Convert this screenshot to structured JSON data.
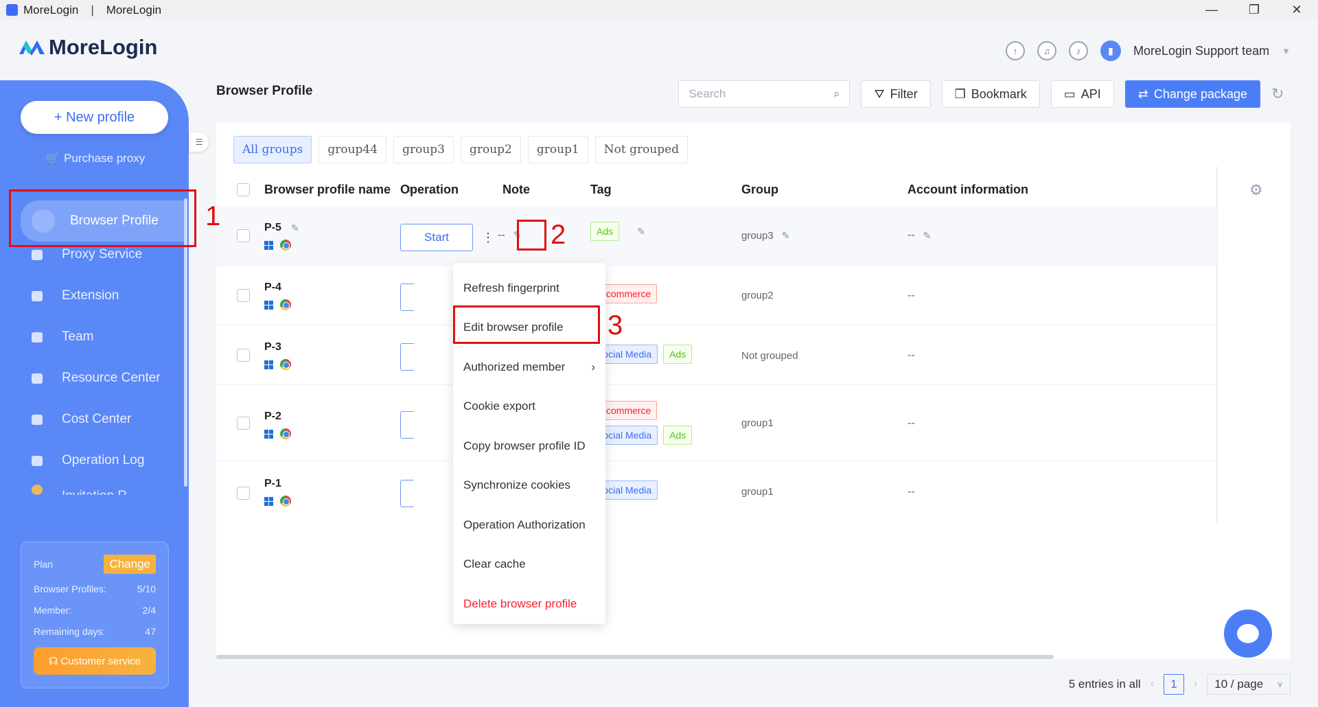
{
  "titlebar": {
    "app_name": "MoreLogin",
    "separator": "|",
    "window_title": "MoreLogin",
    "minimize": "—",
    "maximize": "❐",
    "close": "✕"
  },
  "header": {
    "logo_text": "MoreLogin",
    "team_name": "MoreLogin Support team"
  },
  "sidebar": {
    "new_profile": "+ New profile",
    "purchase_proxy": "Purchase proxy",
    "items": [
      {
        "label": "Browser Profile",
        "icon": "browser-icon"
      },
      {
        "label": "Proxy Service",
        "icon": "proxy-icon"
      },
      {
        "label": "Extension",
        "icon": "puzzle-icon"
      },
      {
        "label": "Team",
        "icon": "team-icon"
      },
      {
        "label": "Resource Center",
        "icon": "cube-icon"
      },
      {
        "label": "Cost Center",
        "icon": "wallet-icon"
      },
      {
        "label": "Operation Log",
        "icon": "log-icon"
      },
      {
        "label": "Invitation R...",
        "icon": "invite-icon"
      }
    ],
    "plan": {
      "title": "Plan",
      "change": "Change",
      "rows": [
        {
          "label": "Browser Profiles:",
          "value": "5/10"
        },
        {
          "label": "Member:",
          "value": "2/4"
        },
        {
          "label": "Remaining days:",
          "value": "47"
        }
      ],
      "customer_service": "Customer service"
    }
  },
  "main": {
    "title": "Browser Profile",
    "search_placeholder": "Search",
    "buttons": {
      "filter": "Filter",
      "bookmark": "Bookmark",
      "api": "API",
      "change_package": "Change package"
    },
    "groups": [
      "All groups",
      "group44",
      "group3",
      "group2",
      "group1",
      "Not grouped"
    ],
    "columns": {
      "name": "Browser profile name",
      "operation": "Operation",
      "note": "Note",
      "tag": "Tag",
      "group": "Group",
      "account": "Account information"
    },
    "start_label": "Start",
    "rows": [
      {
        "name": "P-5",
        "note": "--",
        "tags": [
          [
            "Ads"
          ]
        ],
        "group": "group3",
        "account": "--"
      },
      {
        "name": "P-4",
        "note": "",
        "tags": [
          [
            "E-commerce"
          ]
        ],
        "group": "group2",
        "account": "--"
      },
      {
        "name": "P-3",
        "note": "",
        "tags": [
          [
            "Social Media",
            "Ads"
          ]
        ],
        "group": "Not grouped",
        "account": "--"
      },
      {
        "name": "P-2",
        "note": "",
        "tags": [
          [
            "E-commerce"
          ],
          [
            "Social Media",
            "Ads"
          ]
        ],
        "group": "group1",
        "account": "--"
      },
      {
        "name": "P-1",
        "note": "",
        "tags": [
          [
            "Social Media"
          ]
        ],
        "group": "group1",
        "account": "--"
      }
    ],
    "menu": [
      "Refresh fingerprint",
      "Edit browser profile",
      "Authorized member",
      "Cookie export",
      "Copy browser profile ID",
      "Synchronize cookies",
      "Operation Authorization",
      "Clear cache",
      "Delete browser profile"
    ],
    "pagination": {
      "total": "5 entries in all",
      "page": "1",
      "per_page": "10 / page"
    }
  },
  "annotations": [
    "1",
    "2",
    "3"
  ],
  "colors": {
    "sidebar": "#5a88f7",
    "primary": "#4b7ef6",
    "annotation": "#e01010"
  }
}
